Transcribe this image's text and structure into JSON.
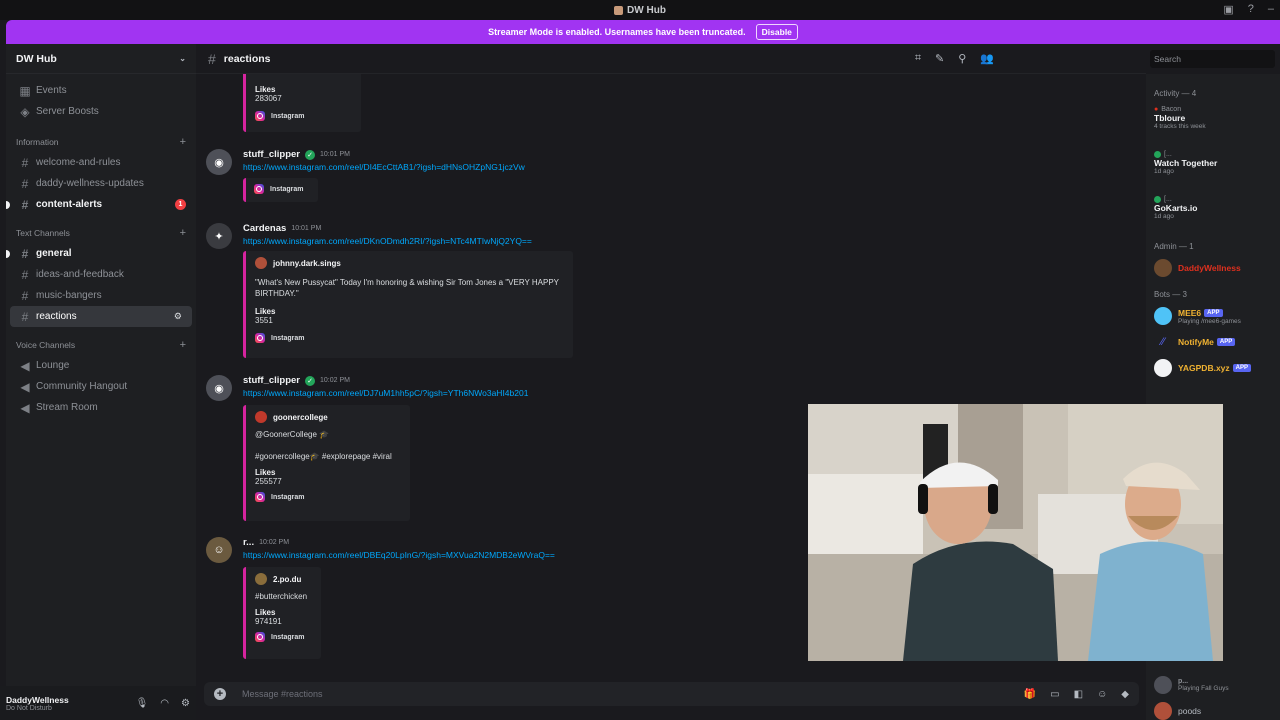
{
  "window": {
    "title": "DW Hub"
  },
  "banner": {
    "text": "Streamer Mode is enabled. Usernames have been truncated.",
    "button": "Disable"
  },
  "server": {
    "name": "DW Hub"
  },
  "sidebar": {
    "top": [
      {
        "label": "Events",
        "icon": "calendar-icon"
      },
      {
        "label": "Server Boosts",
        "icon": "boost-icon"
      }
    ],
    "cat_info": "Information",
    "info_channels": [
      {
        "label": "welcome-and-rules"
      },
      {
        "label": "daddy-wellness-updates"
      },
      {
        "label": "content-alerts",
        "badge": "1"
      }
    ],
    "cat_text": "Text Channels",
    "text_channels": [
      {
        "label": "general"
      },
      {
        "label": "ideas-and-feedback"
      },
      {
        "label": "music-bangers"
      },
      {
        "label": "reactions"
      }
    ],
    "cat_voice": "Voice Channels",
    "voice_channels": [
      {
        "label": "Lounge"
      },
      {
        "label": "Community Hangout"
      },
      {
        "label": "Stream Room"
      }
    ]
  },
  "user": {
    "name": "DaddyWellness",
    "status": "Do Not Disturb"
  },
  "channel": {
    "name": "reactions"
  },
  "search": {
    "placeholder": "Search"
  },
  "messages": [
    {
      "embed": {
        "label": "Likes",
        "value": "283067",
        "footer": "Instagram"
      }
    },
    {
      "author": "stuff_clipper",
      "time": "10:01 PM",
      "link": "https://www.instagram.com/reel/DI4EcCttAB1/?igsh=dHNsOHZpNG1jczVw",
      "embed": {
        "footer": "Instagram"
      }
    },
    {
      "author": "Cardenas",
      "time": "10:01 PM",
      "link": "https://www.instagram.com/reel/DKnODmdh2RI/?igsh=NTc4MTIwNjQ2YQ==",
      "embed": {
        "author": "johnny.dark.sings",
        "text": "\"What's New Pussycat\" Today I'm honoring & wishing Sir Tom Jones a \"VERY HAPPY BIRTHDAY.\"",
        "label": "Likes",
        "value": "3551",
        "footer": "Instagram"
      }
    },
    {
      "author": "stuff_clipper",
      "time": "10:02 PM",
      "link": "https://www.instagram.com/reel/DJ7uM1hh5pC/?igsh=YTh6NWo3aHI4b201",
      "embed": {
        "author": "goonercollege",
        "line1": "@GoonerCollege 🎓",
        "line2": "#goonercollege🎓 #explorepage #viral",
        "label": "Likes",
        "value": "255577",
        "footer": "Instagram"
      }
    },
    {
      "author": "r...",
      "time": "10:02 PM",
      "link": "https://www.instagram.com/reel/DBEq20LpInG/?igsh=MXVua2N2MDB2eWVraQ==",
      "embed": {
        "author": "2.po.du",
        "text": "#butterchicken",
        "label": "Likes",
        "value": "974191",
        "footer": "Instagram"
      }
    }
  ],
  "composer": {
    "placeholder": "Message #reactions"
  },
  "members": {
    "activity_header": "Activity — 4",
    "activities": [
      {
        "top": "Bacon",
        "name": "Tbloure",
        "sub": "4 tracks this week"
      },
      {
        "top": "[...",
        "name": "Watch Together",
        "sub": "1d ago"
      },
      {
        "top": "[...",
        "name": "GoKarts.io",
        "sub": "1d ago"
      }
    ],
    "admin_header": "Admin — 1",
    "admins": [
      {
        "name": "DaddyWellness",
        "color": "#e0301e"
      }
    ],
    "bots_header": "Bots — 3",
    "bots": [
      {
        "name": "MEE6",
        "app": "APP",
        "sub": "Playing /mee6-games",
        "color": "#f0b232"
      },
      {
        "name": "NotifyMe",
        "app": "APP",
        "color": "#f0b232"
      },
      {
        "name": "YAGPDB.xyz",
        "app": "APP",
        "color": "#f0b232"
      }
    ],
    "bottom": [
      {
        "name": "p...",
        "sub": "Playing Fall Guys"
      },
      {
        "name": "poods"
      }
    ]
  }
}
